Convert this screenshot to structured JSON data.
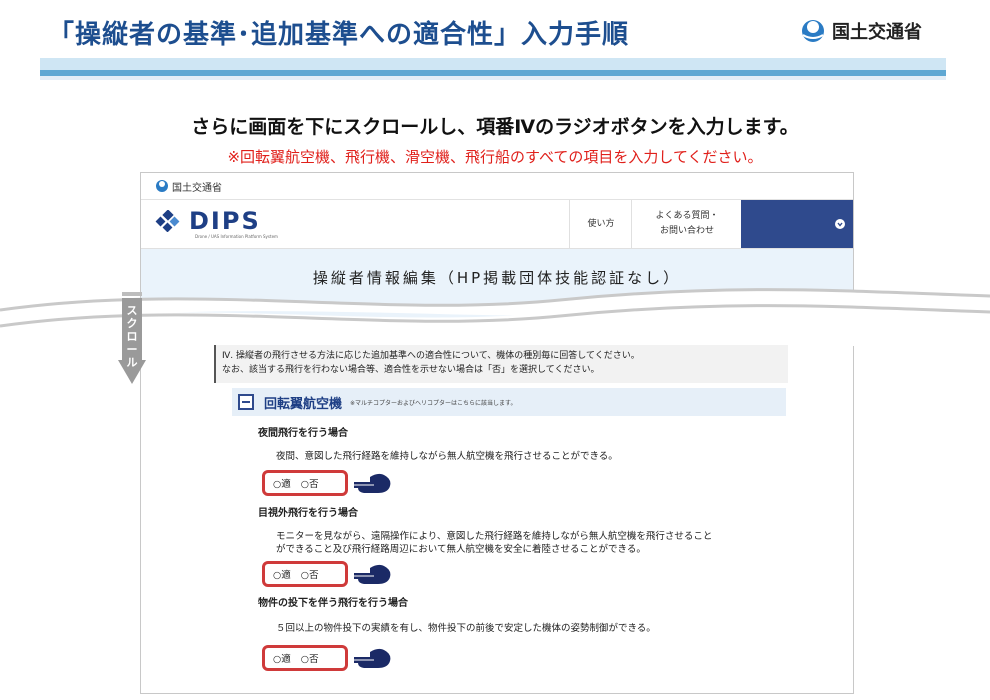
{
  "slide": {
    "title": "「操縦者の基準･追加基準への適合性」入力手順",
    "ministry_logo": "国土交通省",
    "instruction": "さらに画面を下にスクロールし、項番Ⅳのラジオボタンを入力します。",
    "note": "※回転翼航空機、飛行機、滑空機、飛行船のすべての項目を入力してください。",
    "scroll_label": "スクロール"
  },
  "screenshot": {
    "gov_label": "国土交通省",
    "logo": {
      "name": "DIPS",
      "subtitle": "Drone / UAS Information Platform System"
    },
    "nav": {
      "howto": "使い方",
      "faq_line1": "よくある質問・",
      "faq_line2": "お問い合わせ"
    },
    "page_title": "操縦者情報編集（HP掲載団体技能認証なし）",
    "section": {
      "line1": "Ⅳ. 操縦者の飛行させる方法に応じた追加基準への適合性について、機体の種別毎に回答してください。",
      "line2": "なお、該当する飛行を行わない場合等、適合性を示せない場合は「否」を選択してください。"
    },
    "category": {
      "title": "回転翼航空機",
      "note": "※マルチコプターおよびヘリコプターはこちらに該当します。"
    },
    "questions": [
      {
        "title": "夜間飛行を行う場合",
        "desc_line1": "夜間、意図した飛行経路を維持しながら無人航空機を飛行させることができる。",
        "desc_line2": "",
        "opt_yes": "○適",
        "opt_no": "○否"
      },
      {
        "title": "目視外飛行を行う場合",
        "desc_line1": "モニターを見ながら、遠隔操作により、意図した飛行経路を維持しながら無人航空機を飛行させること",
        "desc_line2": "ができること及び飛行経路周辺において無人航空機を安全に着陸させることができる。",
        "opt_yes": "○適",
        "opt_no": "○否"
      },
      {
        "title": "物件の投下を伴う飛行を行う場合",
        "desc_line1": "５回以上の物件投下の実績を有し、物件投下の前後で安定した機体の姿勢制御ができる。",
        "desc_line2": "",
        "opt_yes": "○適",
        "opt_no": "○否"
      }
    ]
  },
  "colors": {
    "title_blue": "#1d4e8f",
    "note_red": "#e0201b",
    "highlight_red": "#cf3a3a",
    "nav_blue": "#2f4a8d"
  }
}
